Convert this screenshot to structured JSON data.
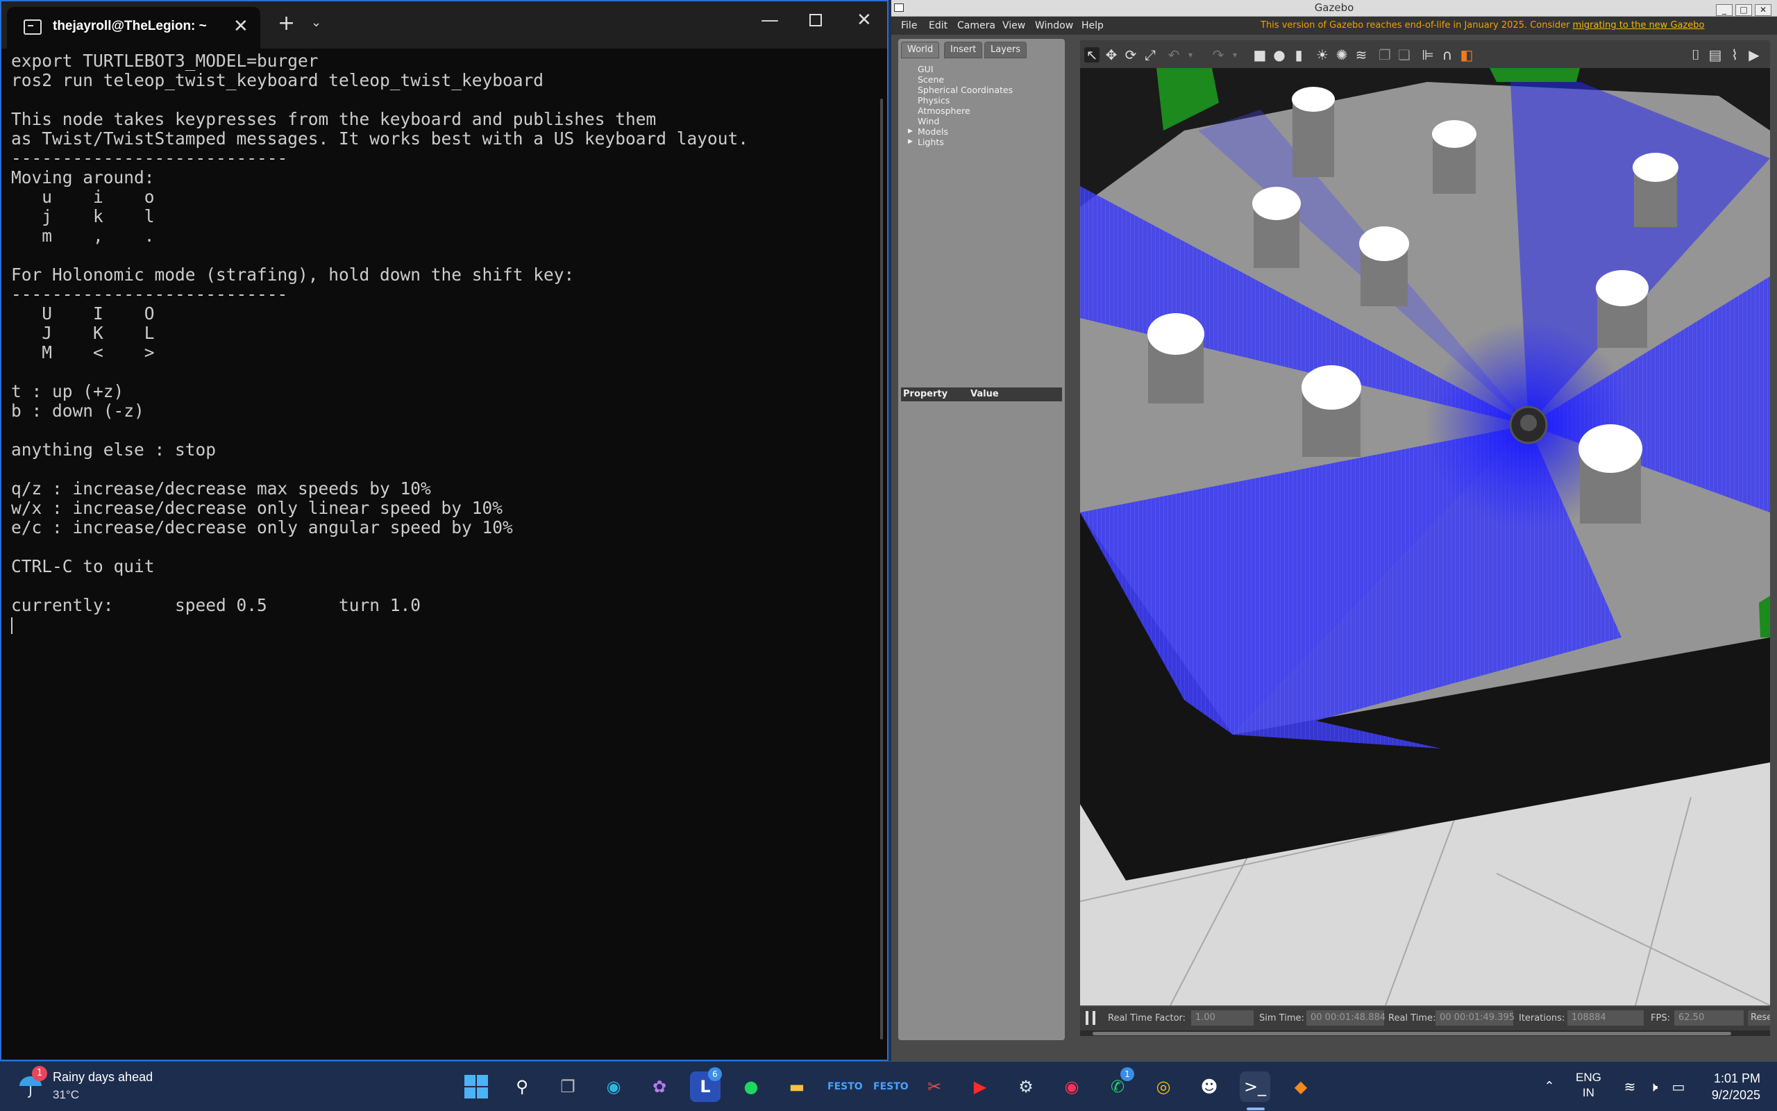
{
  "terminal": {
    "tab_title": "thejayroll@TheLegion: ~",
    "lines": [
      "export TURTLEBOT3_MODEL=burger",
      "ros2 run teleop_twist_keyboard teleop_twist_keyboard",
      "",
      "This node takes keypresses from the keyboard and publishes them",
      "as Twist/TwistStamped messages. It works best with a US keyboard layout.",
      "---------------------------",
      "Moving around:",
      "   u    i    o",
      "   j    k    l",
      "   m    ,    .",
      "",
      "For Holonomic mode (strafing), hold down the shift key:",
      "---------------------------",
      "   U    I    O",
      "   J    K    L",
      "   M    <    >",
      "",
      "t : up (+z)",
      "b : down (-z)",
      "",
      "anything else : stop",
      "",
      "q/z : increase/decrease max speeds by 10%",
      "w/x : increase/decrease only linear speed by 10%",
      "e/c : increase/decrease only angular speed by 10%",
      "",
      "CTRL-C to quit",
      "",
      "currently:      speed 0.5       turn 1.0"
    ]
  },
  "gazebo": {
    "window_title": "Gazebo",
    "menus": [
      "File",
      "Edit",
      "Camera",
      "View",
      "Window",
      "Help"
    ],
    "notice_text": "This version of Gazebo reaches end-of-life in January 2025. Consider ",
    "notice_link": "migrating to the new Gazebo",
    "tabs": [
      "World",
      "Insert",
      "Layers"
    ],
    "tree": [
      "GUI",
      "Scene",
      "Spherical Coordinates",
      "Physics",
      "Atmosphere",
      "Wind",
      "Models",
      "Lights"
    ],
    "property_header": "Property",
    "value_header": "Value",
    "status": {
      "rtf_label": "Real Time Factor:",
      "rtf_value": "1.00",
      "sim_label": "Sim Time:",
      "sim_value": "00 00:01:48.884",
      "real_label": "Real Time:",
      "real_value": "00 00:01:49.395",
      "iter_label": "Iterations:",
      "iter_value": "108884",
      "fps_label": "FPS:",
      "fps_value": "62.50",
      "reset_label": "Rese"
    }
  },
  "taskbar": {
    "weather_title": "Rainy days ahead",
    "weather_temp": "31°C",
    "weather_badge": "1",
    "lang_top": "ENG",
    "lang_bottom": "IN",
    "time": "1:01 PM",
    "date": "9/2/2025",
    "badge_l": "6",
    "badge_whatsapp": "1"
  }
}
